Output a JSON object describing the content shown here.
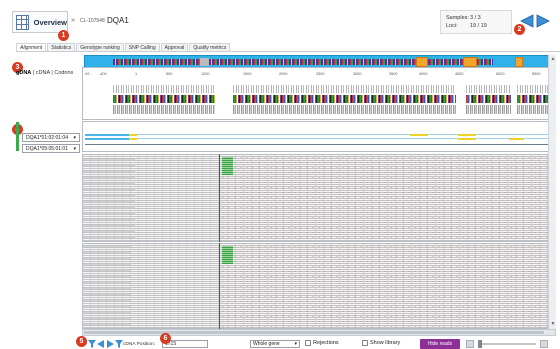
{
  "header": {
    "overview_label": "Overview",
    "separator": "»",
    "sample_id": "CL-107548",
    "gene": "DQA1",
    "counts": [
      {
        "key": "Samples:",
        "value": "3 / 3"
      },
      {
        "key": "Loci:",
        "value": "19 / 19"
      }
    ]
  },
  "callouts": [
    "1",
    "2",
    "3",
    "4",
    "5",
    "6"
  ],
  "tabs": [
    {
      "label": "Alignment",
      "active": true
    },
    {
      "label": "Statistics",
      "active": false
    },
    {
      "label": "Genotype ranking",
      "active": false
    },
    {
      "label": "SNP Calling",
      "active": false
    },
    {
      "label": "Approval",
      "active": false
    },
    {
      "label": "Quality metrics",
      "active": false
    }
  ],
  "track_selector": {
    "gdna": "gDNA",
    "sep1": "|",
    "cdna": "cDNA",
    "sep2": "|",
    "codons": "Codons"
  },
  "ruler_ticks": [
    "-92",
    "-400",
    "1",
    "500",
    "1000",
    "1500",
    "2000",
    "2500",
    "3000",
    "3500",
    "4000",
    "4500",
    "5000",
    "5500"
  ],
  "alleles": [
    {
      "name": "DQA1*01:02:01:04"
    },
    {
      "name": "DQA1*05:05:01:01"
    }
  ],
  "bottom": {
    "position_label": "cDNA Position:",
    "position_value": "1715",
    "region_select": "Whole gene",
    "rejections_label": "Rejections",
    "show_library_label": "Show library",
    "hide_reads_label": "Hide reads"
  },
  "colors": {
    "accent_blue": "#2fb2ea",
    "highlight_orange": "#f2a52a",
    "callout_red": "#d93b22",
    "hide_button_purple": "#8d2f98",
    "allele_green": "#3da94c"
  },
  "icons": [
    "grid-icon",
    "nav-back-icon",
    "nav-forward-icon",
    "dropdown-arrow-icon",
    "filter-icon",
    "arrow-left-icon",
    "arrow-right-icon",
    "zoom-minus-icon",
    "zoom-plus-icon"
  ]
}
